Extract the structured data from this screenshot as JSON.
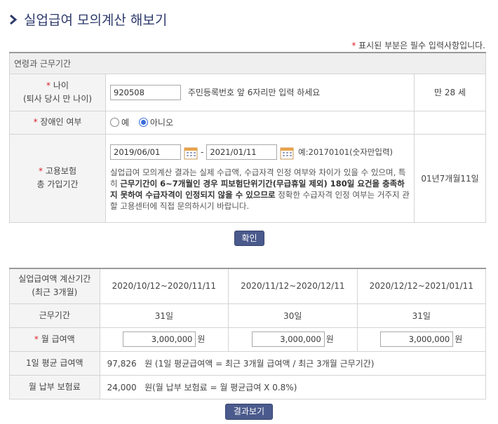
{
  "title": "실업급여 모의계산 해보기",
  "notice": {
    "mark": "*",
    "text": "표시된 부분은 필수 입력사항입니다."
  },
  "section_head": "연령과 근무기간",
  "age": {
    "label_line1": "나이",
    "label_line2": "(퇴사 당시 만 나이)",
    "value": "920508",
    "hint": "주민등록번호 앞 6자리만 입력 하세요",
    "result": "만 28 세"
  },
  "disability": {
    "label": "장애인 여부",
    "yes": "예",
    "no": "아니오",
    "selected": "아니오"
  },
  "employment": {
    "label_line1": "고용보험",
    "label_line2": "총 가입기간",
    "start": "2019/06/01",
    "end": "2021/01/11",
    "dash": "-",
    "example": "예:20170101(숫자만입력)",
    "warning_1": "실업급여 모의계산 결과는 실제 수급액, 수급자격 인정 여부와 차이가 있을 수 있으며, 특히 ",
    "warning_bold": "근무기간이 6~7개월인 경우 피보험단위기간(무급휴일 제외) 180일 요건을 충족하지 못하여 수급자격이 인정되지 않을 수 있으므로",
    "warning_2": " 정확한 수급자격 인정 여부는 거주지 관할 고용센터에 직접 문의하시기 바랍니다.",
    "result": "01년7개월11일"
  },
  "confirm_label": "확인",
  "calc": {
    "period_label_1": "실업급여액 계산기간",
    "period_label_2": "(최근 3개월)",
    "periods": [
      "2020/10/12~2020/11/11",
      "2020/11/12~2020/12/11",
      "2020/12/12~2021/01/11"
    ],
    "days_label": "근무기간",
    "days": [
      "31일",
      "30일",
      "31일"
    ],
    "wage_label": "월 급여액",
    "wages": [
      "3,000,000",
      "3,000,000",
      "3,000,000"
    ],
    "wage_unit": "원",
    "daily_label": "1일 평균 급여액",
    "daily_value": "97,826",
    "daily_desc": "원 (1일 평균급여액 = 최근 3개월 급여액 / 최근 3개월 근무기간)",
    "premium_label": "월 납부 보험료",
    "premium_value": "24,000",
    "premium_desc": "원(월 납부 보험료 = 월 평균급여 X 0.8%)"
  },
  "result_label": "결과보기",
  "colors": {
    "title": "#2d3a6b",
    "required": "#d9232d",
    "button": "#4a5a8c",
    "radio_selected": "#3a6ed8"
  }
}
